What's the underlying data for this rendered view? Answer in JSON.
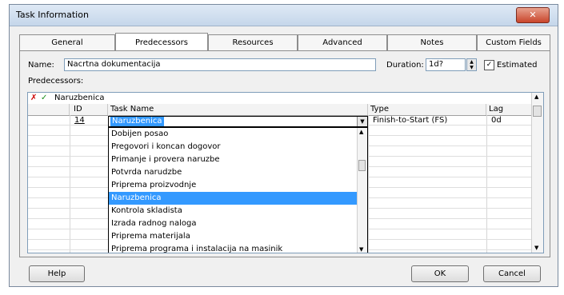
{
  "window": {
    "title": "Task Information",
    "close_glyph": "✕"
  },
  "tabs": [
    {
      "label": "General"
    },
    {
      "label": "Predecessors",
      "active": true
    },
    {
      "label": "Resources"
    },
    {
      "label": "Advanced"
    },
    {
      "label": "Notes"
    },
    {
      "label": "Custom Fields"
    }
  ],
  "form": {
    "name_label": "Name:",
    "name_value": "Nacrtna dokumentacija",
    "duration_label": "Duration:",
    "duration_value": "1d?",
    "estimated_label": "Estimated",
    "estimated_checked": true
  },
  "predecessors": {
    "label": "Predecessors:",
    "cancel_glyph": "✗",
    "accept_glyph": "✓",
    "edit_value": "Naruzbenica",
    "columns": [
      "ID",
      "Task Name",
      "Type",
      "Lag"
    ],
    "row": {
      "id": "14",
      "task_name": "Naruzbenica",
      "type": "Finish-to-Start (FS)",
      "lag": "0d"
    },
    "dropdown_options": [
      "Dobijen posao",
      "Pregovori i koncan dogovor",
      "Primanje i provera naruzbe",
      "Potvrda narudzbe",
      "Priprema proizvodnje",
      "Naruzbenica",
      "Kontrola skladista",
      "Izrada radnog naloga",
      "Priprema materijala",
      "Priprema programa i instalacija na masinik"
    ],
    "selected_option": "Naruzbenica"
  },
  "buttons": {
    "help": "Help",
    "ok": "OK",
    "cancel": "Cancel"
  },
  "colors": {
    "selection": "#3399ff",
    "close_button": "#c9452b"
  }
}
